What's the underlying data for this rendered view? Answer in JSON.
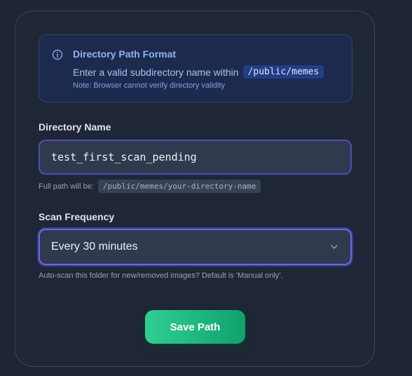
{
  "info": {
    "title": "Directory Path Format",
    "line_text": "Enter a valid subdirectory name within",
    "line_code": "/public/memes",
    "note": "Note: Browser cannot verify directory validity",
    "icon": "info-circle-icon"
  },
  "directory": {
    "label": "Directory Name",
    "value": "test_first_scan_pending",
    "hint_text": "Full path will be:",
    "hint_code": "/public/memes/your-directory-name"
  },
  "frequency": {
    "label": "Scan Frequency",
    "selected": "Every 30 minutes",
    "hint": "Auto-scan this folder for new/removed images? Default is 'Manual only'."
  },
  "actions": {
    "save_label": "Save Path"
  },
  "colors": {
    "accent": "#6b67e8",
    "save_button": "#22c084",
    "info_text": "#8fb4f5"
  }
}
